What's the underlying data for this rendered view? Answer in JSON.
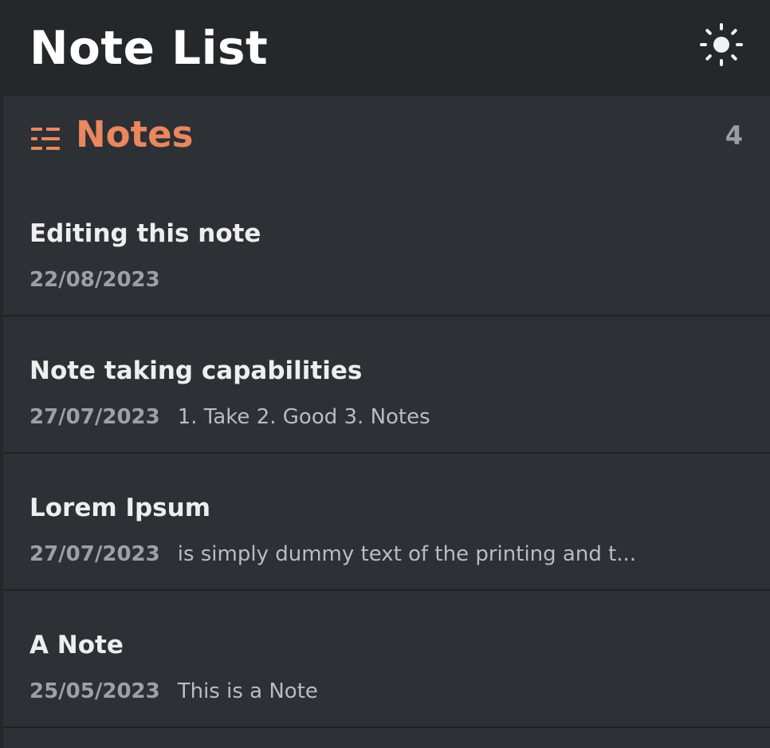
{
  "header": {
    "title": "Note List",
    "theme_icon": "sun-icon"
  },
  "section": {
    "icon": "list-icon",
    "title": "Notes",
    "count": "4"
  },
  "notes": [
    {
      "title": "Editing this note",
      "date": "22/08/2023",
      "preview": ""
    },
    {
      "title": "Note taking capabilities",
      "date": "27/07/2023",
      "preview": "1. Take 2. Good 3. Notes"
    },
    {
      "title": "Lorem Ipsum",
      "date": "27/07/2023",
      "preview": "is simply dummy text of the printing and t..."
    },
    {
      "title": "A Note",
      "date": "25/05/2023",
      "preview": "This is a Note"
    }
  ],
  "colors": {
    "background": "#2d3034",
    "topbar": "#25272a",
    "accent": "#e9875f",
    "title_text": "#ffffff",
    "muted_text": "#9da0a5"
  }
}
